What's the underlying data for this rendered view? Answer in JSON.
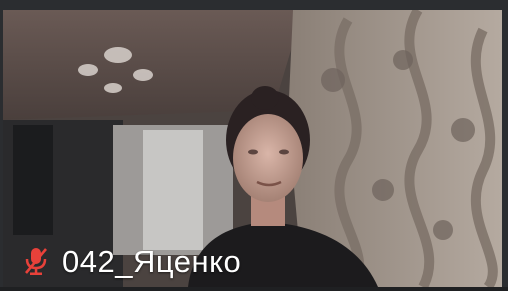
{
  "participant": {
    "name": "042_Яценко",
    "mic_status_icon": "mic-muted-icon"
  },
  "colors": {
    "mic_muted": "#e8413a",
    "name_text": "#ffffff",
    "frame": "#2b2d30"
  }
}
